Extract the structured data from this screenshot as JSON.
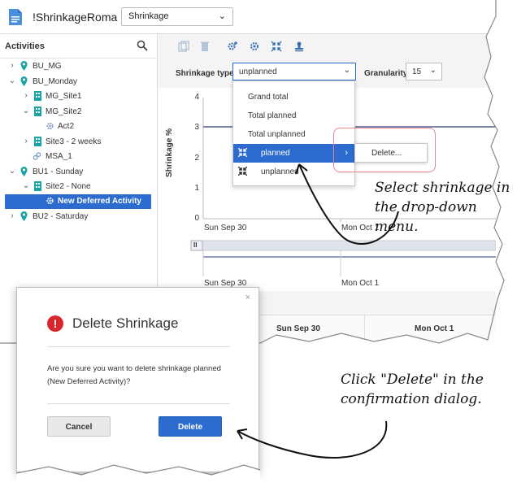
{
  "app": {
    "title": "!ShrinkageRoma",
    "unit_select": "Shrinkage"
  },
  "sidebar": {
    "title": "Activities",
    "items": [
      {
        "label": "BU_MG",
        "type": "bu"
      },
      {
        "label": "BU_Monday",
        "type": "bu"
      },
      {
        "label": "MG_Site1",
        "type": "site"
      },
      {
        "label": "MG_Site2",
        "type": "site"
      },
      {
        "label": "Act2",
        "type": "activity"
      },
      {
        "label": "Site3 - 2 weeks",
        "type": "site"
      },
      {
        "label": "MSA_1",
        "type": "msa"
      },
      {
        "label": "BU1 - Sunday",
        "type": "bu"
      },
      {
        "label": "Site2 - None",
        "type": "site"
      },
      {
        "label": "New Deferred Activity",
        "type": "activity",
        "selected": true
      },
      {
        "label": "BU2 - Saturday",
        "type": "bu"
      }
    ]
  },
  "filters": {
    "shrinkage_type_label": "Shrinkage type",
    "shrinkage_type_value": "unplanned",
    "granularity_label": "Granularity",
    "granularity_value": "15"
  },
  "dropdown": {
    "options": [
      "Grand total",
      "Total planned",
      "Total unplanned",
      "planned",
      "unplanned"
    ],
    "highlighted": "planned",
    "submenu_item": "Delete..."
  },
  "chart": {
    "y_axis_title": "Shrinkage %",
    "y_ticks": [
      "4",
      "3",
      "2",
      "1",
      "0"
    ],
    "x_ticks": [
      "Sun Sep 30",
      "Mon Oct 1"
    ],
    "overview_x_ticks": [
      "Sun Sep 30",
      "Mon Oct 1"
    ],
    "pause_glyph": "II"
  },
  "grid_header": {
    "columns": [
      "Sun Sep 30",
      "Mon Oct 1"
    ]
  },
  "dialog": {
    "title": "Delete Shrinkage",
    "close_glyph": "×",
    "message": "Are you sure you want to delete shrinkage planned (New Deferred Activity)?",
    "cancel_label": "Cancel",
    "delete_label": "Delete"
  },
  "annotations": {
    "step1": "Select shrinkage  in the drop-down menu.",
    "step2": "Click \"Delete\" in the confirmation dialog."
  },
  "colors": {
    "accent": "#2d6ccf",
    "error": "#d9262c",
    "callout": "#e48a8a",
    "site_icon": "#1aa3a3"
  }
}
